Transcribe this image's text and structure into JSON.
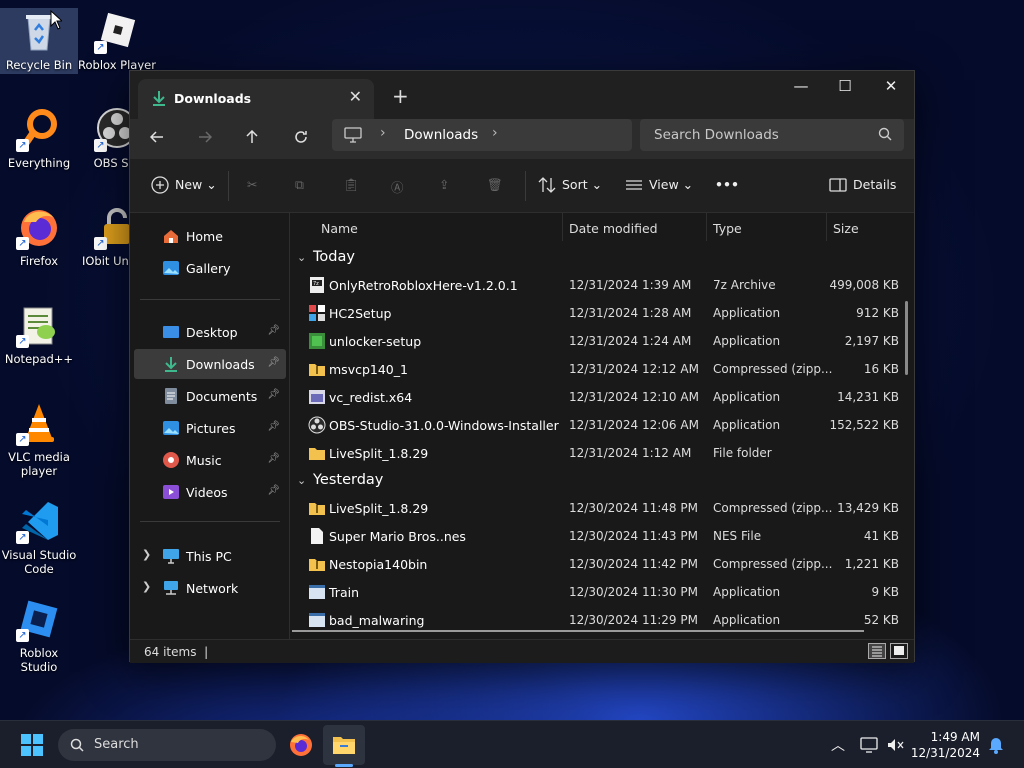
{
  "desktop": {
    "icons": [
      {
        "label": "Recycle Bin"
      },
      {
        "label": "Roblox Player"
      },
      {
        "label": "Everything"
      },
      {
        "label": "OBS Stu"
      },
      {
        "label": "Firefox"
      },
      {
        "label": "IObit Unlock"
      },
      {
        "label": "Notepad++"
      },
      {
        "label": "VLC media player"
      },
      {
        "label": "Visual Studio Code"
      },
      {
        "label": "Roblox Studio"
      }
    ]
  },
  "window": {
    "tab_title": "Downloads",
    "tab_close": "✕",
    "new_tab": "+",
    "minimize": "—",
    "maximize": "☐",
    "close": "✕",
    "address": {
      "crumb": "Downloads"
    },
    "search_placeholder": "Search Downloads",
    "commands": {
      "new": "New",
      "sort": "Sort",
      "view": "View",
      "more": "•••",
      "details": "Details"
    },
    "sidebar": {
      "items": [
        {
          "label": "Home"
        },
        {
          "label": "Gallery"
        },
        {
          "label": "Desktop"
        },
        {
          "label": "Downloads"
        },
        {
          "label": "Documents"
        },
        {
          "label": "Pictures"
        },
        {
          "label": "Music"
        },
        {
          "label": "Videos"
        },
        {
          "label": "This PC"
        },
        {
          "label": "Network"
        }
      ]
    },
    "columns": {
      "name": "Name",
      "date": "Date modified",
      "type": "Type",
      "size": "Size"
    },
    "groups": {
      "today": {
        "label": "Today",
        "files": [
          {
            "name": "OnlyRetroRobloxHere-v1.2.0.1",
            "date": "12/31/2024 1:39 AM",
            "type": "7z Archive",
            "size": "499,008 KB"
          },
          {
            "name": "HC2Setup",
            "date": "12/31/2024 1:28 AM",
            "type": "Application",
            "size": "912 KB"
          },
          {
            "name": "unlocker-setup",
            "date": "12/31/2024 1:24 AM",
            "type": "Application",
            "size": "2,197 KB"
          },
          {
            "name": "msvcp140_1",
            "date": "12/31/2024 12:12 AM",
            "type": "Compressed (zipp...",
            "size": "16 KB"
          },
          {
            "name": "vc_redist.x64",
            "date": "12/31/2024 12:10 AM",
            "type": "Application",
            "size": "14,231 KB"
          },
          {
            "name": "OBS-Studio-31.0.0-Windows-Installer",
            "date": "12/31/2024 12:06 AM",
            "type": "Application",
            "size": "152,522 KB"
          },
          {
            "name": "LiveSplit_1.8.29",
            "date": "12/31/2024 1:12 AM",
            "type": "File folder",
            "size": ""
          }
        ]
      },
      "yesterday": {
        "label": "Yesterday",
        "files": [
          {
            "name": "LiveSplit_1.8.29",
            "date": "12/30/2024 11:48 PM",
            "type": "Compressed (zipp...",
            "size": "13,429 KB"
          },
          {
            "name": "Super Mario Bros..nes",
            "date": "12/30/2024 11:43 PM",
            "type": "NES File",
            "size": "41 KB"
          },
          {
            "name": "Nestopia140bin",
            "date": "12/30/2024 11:42 PM",
            "type": "Compressed (zipp...",
            "size": "1,221 KB"
          },
          {
            "name": "Train",
            "date": "12/30/2024 11:30 PM",
            "type": "Application",
            "size": "9 KB"
          },
          {
            "name": "bad_malwaring",
            "date": "12/30/2024 11:29 PM",
            "type": "Application",
            "size": "52 KB"
          }
        ]
      }
    },
    "status": {
      "count": "64 items"
    }
  },
  "taskbar": {
    "search_placeholder": "Search",
    "time": "1:49 AM",
    "date": "12/31/2024"
  },
  "colors": {
    "window_bg": "#191919",
    "accent": "#5aa9ff",
    "taskbar_bg": "#1b1f2b"
  }
}
